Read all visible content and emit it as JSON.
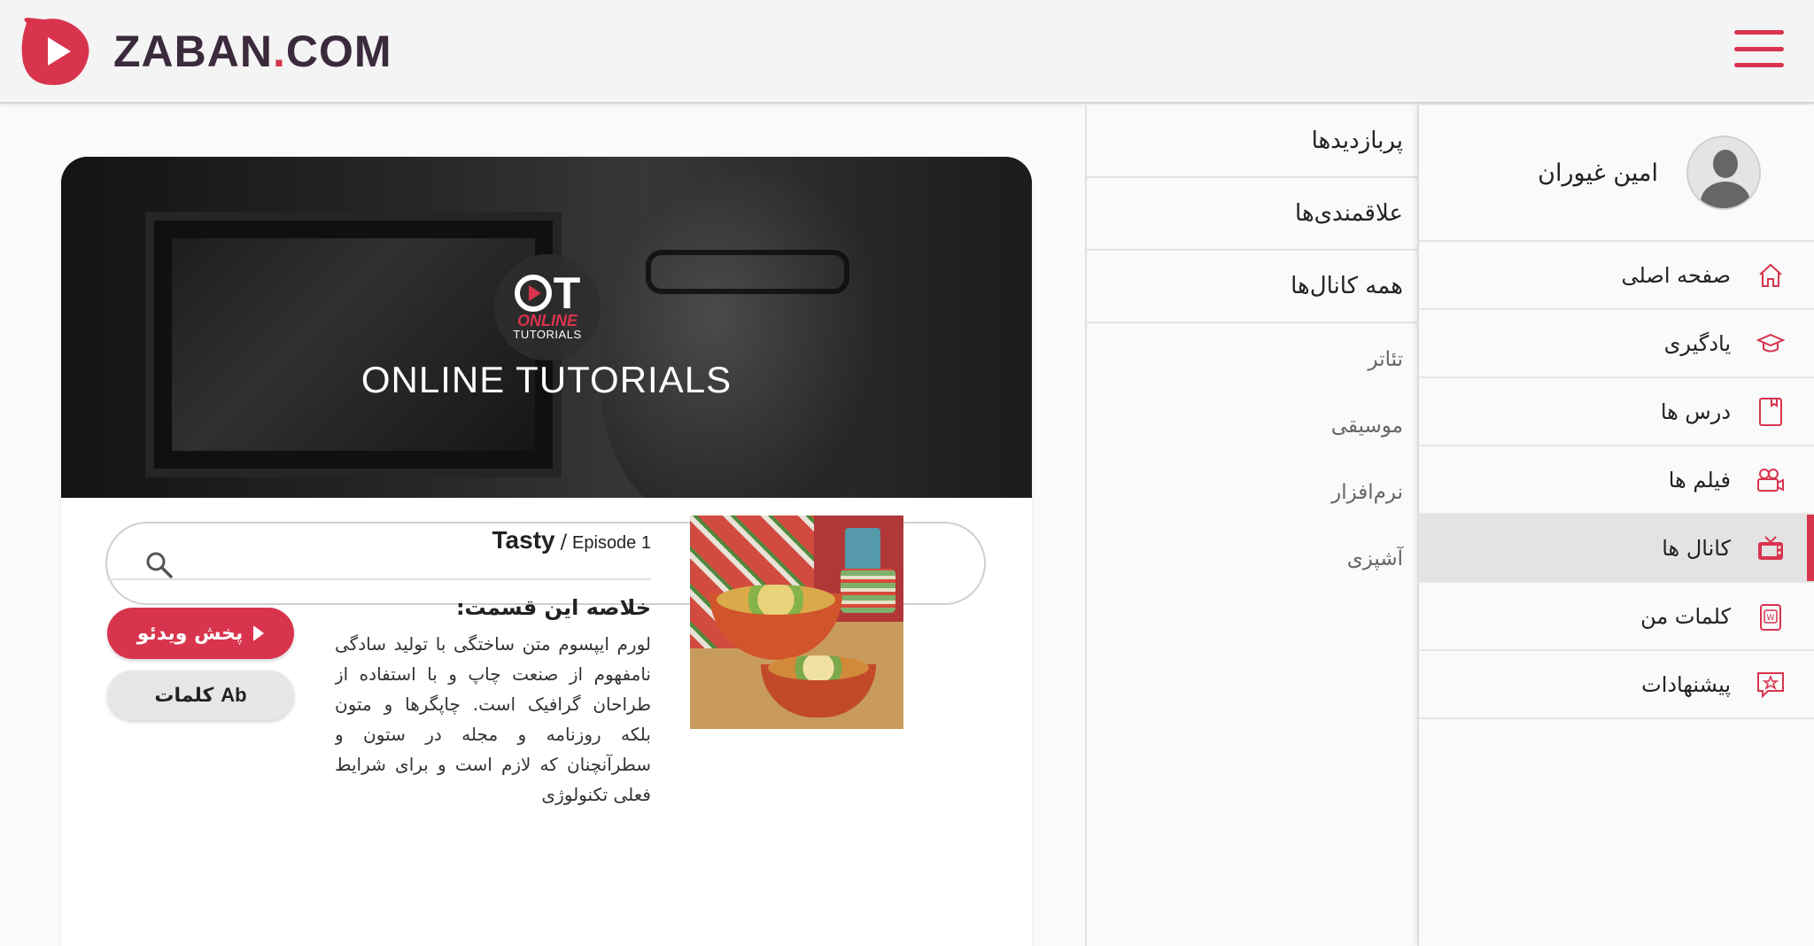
{
  "header": {
    "brand_main": "ZABAN",
    "brand_dot": ".",
    "brand_tld": "COM",
    "menu_icon": "hamburger-menu-icon",
    "accent_color": "#d8344e"
  },
  "sidebar": {
    "profile_name": "امین غیوران",
    "items": [
      {
        "label": "صفحه اصلی",
        "icon": "home-icon",
        "active": false
      },
      {
        "label": "یادگیری",
        "icon": "graduation-cap-icon",
        "active": false
      },
      {
        "label": "درس ها",
        "icon": "book-icon",
        "active": false
      },
      {
        "label": "فیلم ها",
        "icon": "video-camera-icon",
        "active": false
      },
      {
        "label": "کانال ها",
        "icon": "tv-icon",
        "active": true
      },
      {
        "label": "کلمات من",
        "icon": "word-card-icon",
        "active": false
      },
      {
        "label": "پیشنهادات",
        "icon": "star-chat-icon",
        "active": false
      }
    ]
  },
  "channels_menu": {
    "main": [
      "پربازدیدها",
      "علاقمندی‌ها",
      "همه کانال‌ها"
    ],
    "categories": [
      "تئاتر",
      "موسیقی",
      "نرم‌افزار",
      "آشپزی"
    ]
  },
  "channel": {
    "logo_top": "OT",
    "logo_online": "ONLINE",
    "logo_tutorials": "TUTORIALS",
    "banner_title": "ONLINE TUTORIALS",
    "search_placeholder": "جستجو"
  },
  "episode": {
    "name": "Tasty",
    "separator": "/",
    "number": "Episode 1",
    "summary_title": "خلاصه این قسمت:",
    "summary_text": "لورم ایپسوم متن ساختگی با تولید سادگی نامفهوم از صنعت چاپ و با استفاده از طراحان گرافیک است. چاپگرها و متون بلکه روزنامه و مجله در ستون و سطرآنچنان که لازم است و برای شرایط فعلی تکنولوژی",
    "play_label": "پخش ویدئو",
    "words_ab": "Ab",
    "words_label": "کلمات"
  }
}
